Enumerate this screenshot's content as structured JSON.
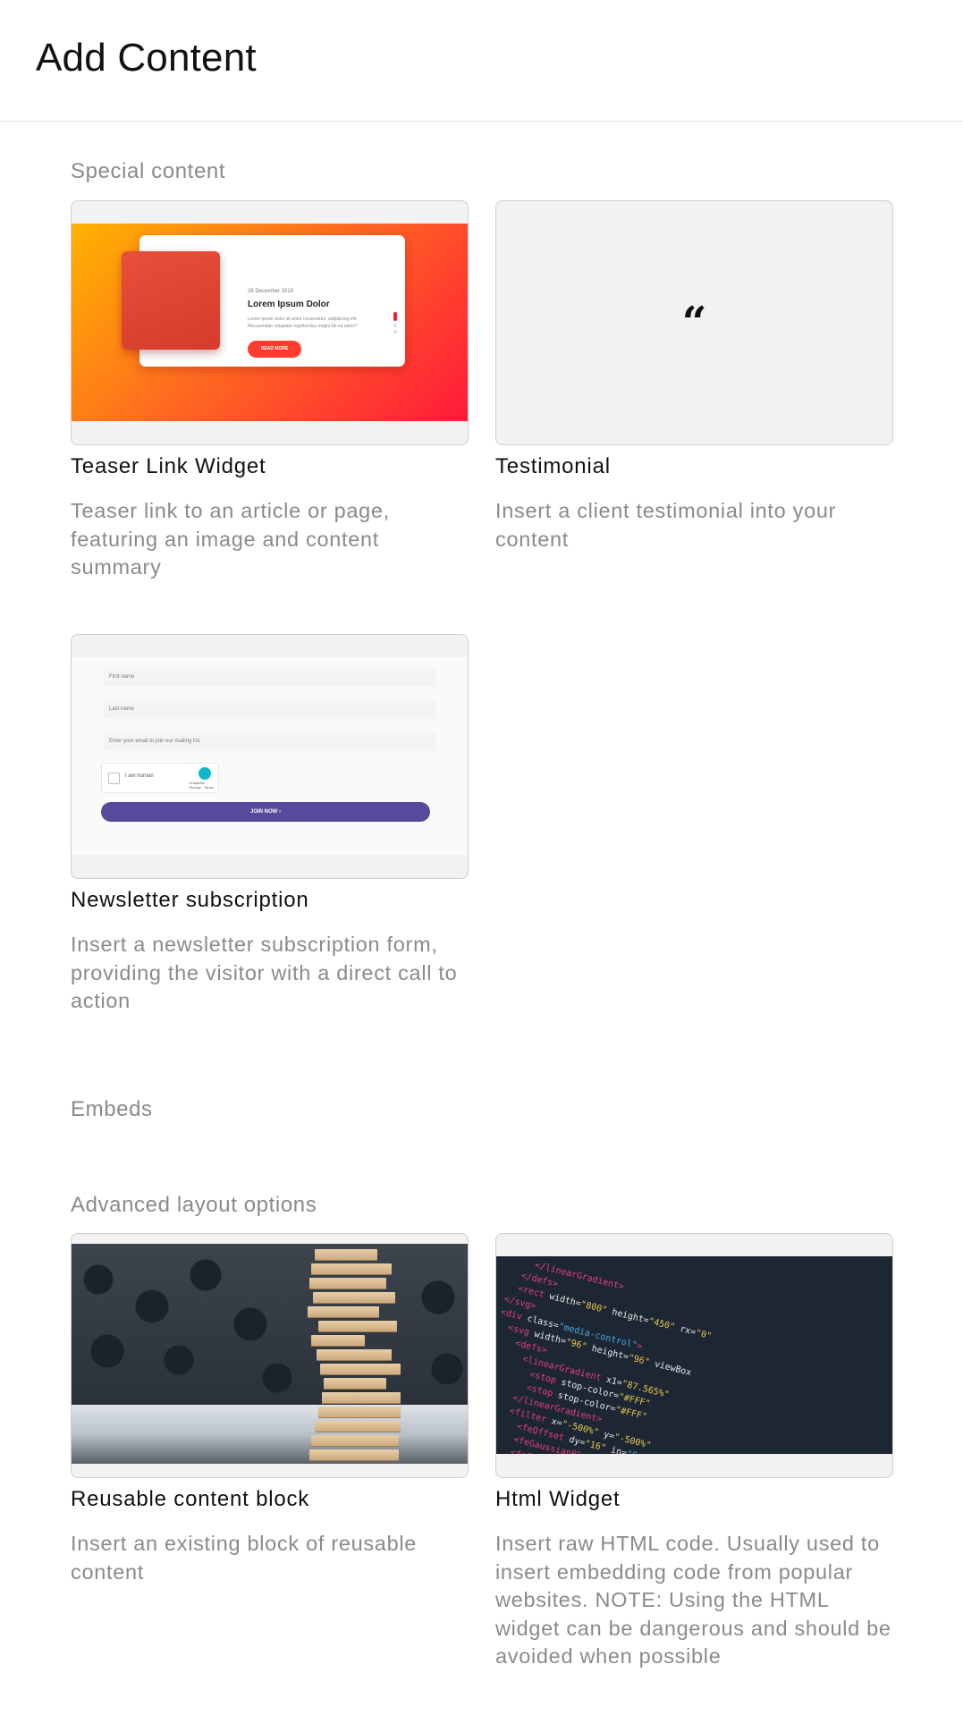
{
  "page": {
    "title": "Add Content"
  },
  "sections": {
    "special": {
      "title": "Special content",
      "teaser": {
        "title": "Teaser Link Widget",
        "desc": "Teaser link to an article or page, featuring an image and content summary",
        "preview": {
          "date": "26 December 2019",
          "heading": "Lorem Ipsum Dolor",
          "text": "Lorem ipsum dolor sit amet consectetur, adipisicing elit. Recusandae voluptate repellendus magni illo ea animi?",
          "button": "READ MORE"
        }
      },
      "testimonial": {
        "title": "Testimonial",
        "desc": "Insert a client testimonial into your content",
        "glyph": "“"
      },
      "newsletter": {
        "title": "Newsletter subscription",
        "desc": "Insert a newsletter subscription form, providing the visitor with a direct call to action",
        "preview": {
          "first_name": "First name",
          "last_name": "Last name",
          "email": "Enter your email to join our mailing list",
          "captcha_label": "I am human",
          "captcha_brand": "hCaptcha",
          "captcha_links": "Privacy - Terms",
          "join": "JOIN NOW ›"
        }
      }
    },
    "embeds": {
      "title": "Embeds"
    },
    "advanced": {
      "title": "Advanced layout options",
      "reusable": {
        "title": "Reusable content block",
        "desc": "Insert an existing block of reusable content"
      },
      "html": {
        "title": "Html Widget",
        "desc": "Insert raw HTML code. Usually used to insert embedding code from popular websites. NOTE: Using the HTML widget can be dangerous and should be avoided when possible"
      }
    }
  },
  "colors": {
    "teaser_gradient": [
      "#ffb300",
      "#ff6d1f",
      "#ff1a3a"
    ],
    "newsletter_button": "#554a9c",
    "muted_text": "#8a8a8a"
  }
}
